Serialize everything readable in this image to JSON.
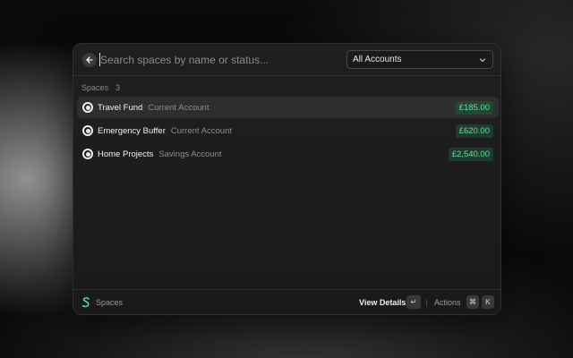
{
  "search": {
    "placeholder": "Search spaces by name or status...",
    "account_filter": "All Accounts"
  },
  "section": {
    "title": "Spaces",
    "count": "3"
  },
  "spaces": [
    {
      "name": "Travel Fund",
      "type": "Current Account",
      "amount": "£185.00",
      "selected": true
    },
    {
      "name": "Emergency Buffer",
      "type": "Current Account",
      "amount": "£620.00",
      "selected": false
    },
    {
      "name": "Home Projects",
      "type": "Savings Account",
      "amount": "£2,540.00",
      "selected": false
    }
  ],
  "footer": {
    "app_label": "Spaces",
    "primary_action": "View Details",
    "enter_key": "↵",
    "actions_label": "Actions",
    "cmd_key": "⌘",
    "k_key": "K"
  },
  "colors": {
    "amount_text": "#5fe0a2",
    "amount_bg": "#1f3b2d",
    "logo": "#5fe0a2"
  },
  "icons": {
    "back": "arrow-left-icon",
    "dropdown": "chevron-down-icon",
    "radio": "radio-selected-icon",
    "logo": "spaces-logo-icon"
  }
}
